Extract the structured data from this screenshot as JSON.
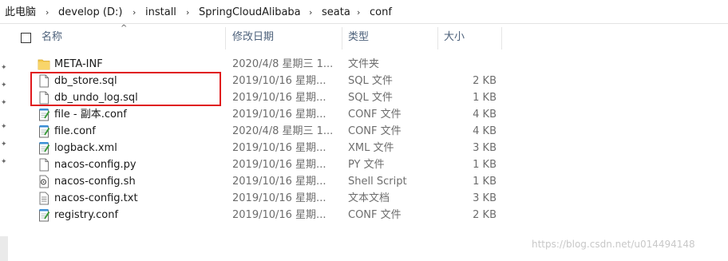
{
  "breadcrumb": {
    "items": [
      "此电脑",
      "develop (D:)",
      "install",
      "SpringCloudAlibaba",
      "seata",
      "conf"
    ],
    "separator": "›"
  },
  "columns": {
    "name": "名称",
    "date": "修改日期",
    "type": "类型",
    "size": "大小"
  },
  "files": [
    {
      "name": "META-INF",
      "date": "2020/4/8 星期三 1...",
      "type": "文件夹",
      "size": "",
      "icon": "folder-icon"
    },
    {
      "name": "db_store.sql",
      "date": "2019/10/16 星期...",
      "type": "SQL 文件",
      "size": "2 KB",
      "icon": "document-icon"
    },
    {
      "name": "db_undo_log.sql",
      "date": "2019/10/16 星期...",
      "type": "SQL 文件",
      "size": "1 KB",
      "icon": "document-icon"
    },
    {
      "name": "file - 副本.conf",
      "date": "2019/10/16 星期...",
      "type": "CONF 文件",
      "size": "4 KB",
      "icon": "notepad-icon"
    },
    {
      "name": "file.conf",
      "date": "2020/4/8 星期三 1...",
      "type": "CONF 文件",
      "size": "4 KB",
      "icon": "notepad-icon"
    },
    {
      "name": "logback.xml",
      "date": "2019/10/16 星期...",
      "type": "XML 文件",
      "size": "3 KB",
      "icon": "notepad-icon"
    },
    {
      "name": "nacos-config.py",
      "date": "2019/10/16 星期...",
      "type": "PY 文件",
      "size": "1 KB",
      "icon": "document-icon"
    },
    {
      "name": "nacos-config.sh",
      "date": "2019/10/16 星期...",
      "type": "Shell Script",
      "size": "1 KB",
      "icon": "script-icon"
    },
    {
      "name": "nacos-config.txt",
      "date": "2019/10/16 星期...",
      "type": "文本文档",
      "size": "3 KB",
      "icon": "text-document-icon"
    },
    {
      "name": "registry.conf",
      "date": "2019/10/16 星期...",
      "type": "CONF 文件",
      "size": "2 KB",
      "icon": "notepad-icon"
    }
  ],
  "watermark": "https://blog.csdn.net/u014494148",
  "colors": {
    "highlight": "#e0191d",
    "folder": "#f4c94b",
    "header_text": "#4c607a"
  }
}
